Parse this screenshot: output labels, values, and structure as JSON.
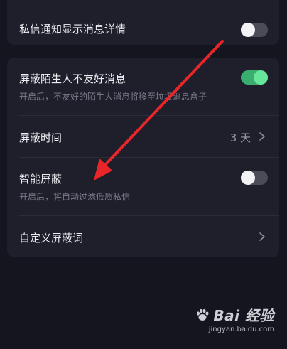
{
  "settings": {
    "top_item": {
      "title": "私信通知显示消息详情",
      "toggle_on": false
    },
    "items": [
      {
        "title": "屏蔽陌生人不友好消息",
        "description": "开启后，不友好的陌生人消息将移至垃圾消息盒子",
        "toggle_on": true
      },
      {
        "title": "屏蔽时间",
        "value": "3 天"
      },
      {
        "title": "智能屏蔽",
        "description": "开启后，将自动过滤低质私信",
        "toggle_on": false
      },
      {
        "title": "自定义屏蔽词"
      }
    ]
  },
  "annotation": {
    "arrow_color": "#e8262a"
  },
  "watermark": {
    "logo": "Bai 经验",
    "url": "jingyan.baidu.com"
  },
  "colors": {
    "background": "#15151f",
    "card": "#1f1f2b",
    "toggle_on": "#3aae6f",
    "toggle_off": "#4c4c58"
  }
}
